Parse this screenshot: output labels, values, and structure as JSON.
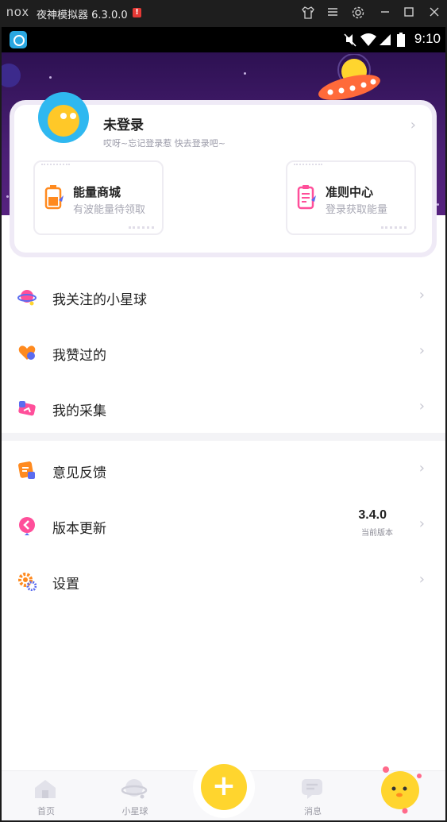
{
  "window": {
    "brand": "nox",
    "title": "夜神模拟器 6.3.0.0",
    "warning_glyph": "!",
    "buttons": [
      "shirt-icon",
      "menu-icon",
      "settings-icon",
      "minimize-icon",
      "maximize-icon",
      "close-icon"
    ]
  },
  "statusbar": {
    "icons": [
      "mute-icon",
      "wifi-icon",
      "signal-icon",
      "battery-icon"
    ],
    "time": "9:10"
  },
  "profile": {
    "name": "未登录",
    "subtitle": "哎呀~忘记登录惹 快去登录吧~",
    "cards": [
      {
        "title": "能量商城",
        "desc": "有波能量待领取",
        "icon": "energy-battery-icon",
        "color": "#ff8a1f"
      },
      {
        "title": "准则中心",
        "desc": "登录获取能量",
        "icon": "clipboard-icon",
        "color": "#ff4f9a"
      }
    ]
  },
  "menu_group1": [
    {
      "label": "我关注的小星球",
      "icon": "planet-icon"
    },
    {
      "label": "我赞过的",
      "icon": "heart-like-icon"
    },
    {
      "label": "我的采集",
      "icon": "collection-icon"
    }
  ],
  "menu_group2": [
    {
      "label": "意见反馈",
      "icon": "feedback-icon"
    },
    {
      "label": "版本更新",
      "icon": "update-icon",
      "version": "3.4.0",
      "version_label": "当前版本"
    },
    {
      "label": "设置",
      "icon": "settings-gear-icon"
    }
  ],
  "tabbar": {
    "tabs": [
      {
        "label": "首页",
        "icon": "home-icon"
      },
      {
        "label": "小星球",
        "icon": "planet-tab-icon"
      },
      {
        "label": "消息",
        "icon": "message-icon"
      },
      {
        "label": "",
        "icon": "mascot-avatar-icon"
      }
    ],
    "fab_symbol": "+"
  },
  "colors": {
    "header_bg": "#4a1f74",
    "accent_yellow": "#ffd52e",
    "avatar_blue": "#2fb8f0"
  }
}
